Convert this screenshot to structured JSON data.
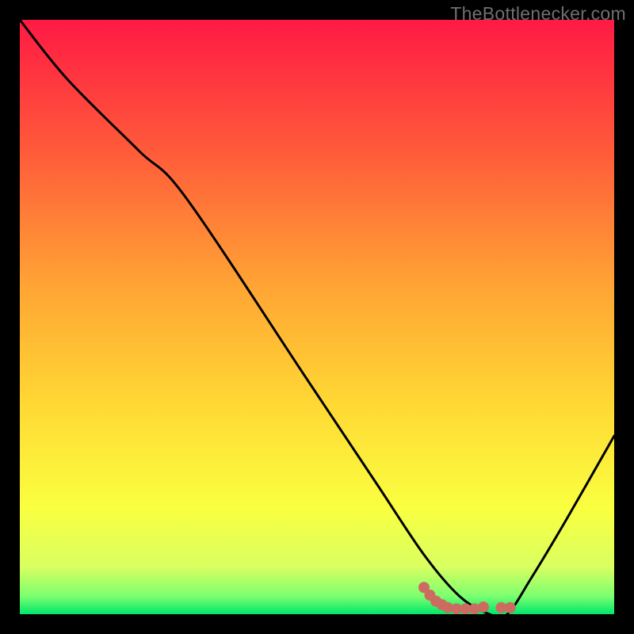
{
  "attribution": "TheBottlenecker.com",
  "chart_data": {
    "type": "line",
    "title": "",
    "xlabel": "",
    "ylabel": "",
    "xlim": [
      0,
      100
    ],
    "ylim": [
      0,
      100
    ],
    "gradient_stops": [
      {
        "offset": 0,
        "color": "#ff1a44"
      },
      {
        "offset": 22,
        "color": "#ff5a3a"
      },
      {
        "offset": 45,
        "color": "#ffa534"
      },
      {
        "offset": 65,
        "color": "#ffd934"
      },
      {
        "offset": 82,
        "color": "#faff40"
      },
      {
        "offset": 92,
        "color": "#d9ff60"
      },
      {
        "offset": 97,
        "color": "#7bff70"
      },
      {
        "offset": 100,
        "color": "#00e66a"
      }
    ],
    "series": [
      {
        "name": "bottleneck-curve",
        "x": [
          0,
          8,
          20,
          28,
          48,
          60,
          68,
          74,
          79,
          82,
          86,
          92,
          100
        ],
        "y": [
          100,
          90,
          78,
          70,
          40,
          22,
          10,
          3,
          0,
          0,
          6,
          16,
          30
        ]
      }
    ],
    "highlight": {
      "name": "optimal-zone",
      "color": "#cc6c60",
      "points": [
        {
          "x": 68,
          "y": 4.5
        },
        {
          "x": 69,
          "y": 3.2
        },
        {
          "x": 70,
          "y": 2.2
        },
        {
          "x": 71,
          "y": 1.6
        },
        {
          "x": 72,
          "y": 1.1
        },
        {
          "x": 73.5,
          "y": 0.9
        },
        {
          "x": 75,
          "y": 0.9
        },
        {
          "x": 76.5,
          "y": 0.9
        },
        {
          "x": 78,
          "y": 1.2
        },
        {
          "x": 81,
          "y": 1.1
        },
        {
          "x": 82.5,
          "y": 1.1
        }
      ]
    }
  }
}
